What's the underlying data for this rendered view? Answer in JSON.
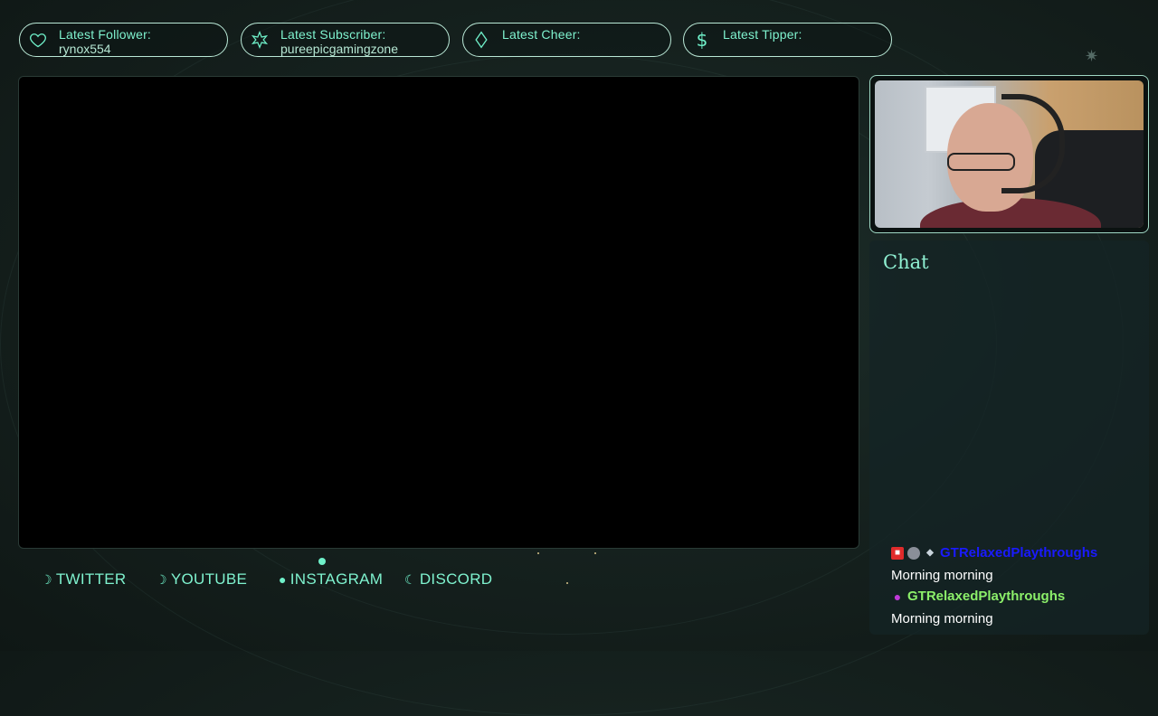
{
  "alerts": [
    {
      "label": "Latest Follower:",
      "value": "rynox554",
      "icon": "heart-icon"
    },
    {
      "label": "Latest Subscriber:",
      "value": "pureepicgamingzone",
      "icon": "star-icon"
    },
    {
      "label": "Latest Cheer:",
      "value": "",
      "icon": "diamond-icon"
    },
    {
      "label": "Latest Tipper:",
      "value": "",
      "icon": "dollar-icon"
    }
  ],
  "chat": {
    "title": "Chat",
    "messages": [
      {
        "user": "GTRelaxedPlaythroughs",
        "text": "Morning morning",
        "name_color": "#1a1aff",
        "badges": [
          "camera-badge",
          "globe-badge",
          "diamond-badge"
        ]
      },
      {
        "user": "GTRelaxedPlaythroughs",
        "text": "Morning morning",
        "name_color": "#8cf06a",
        "badges": [
          "mic-badge"
        ]
      }
    ]
  },
  "socials": [
    {
      "label": "TWITTER",
      "icon": "moon-icon"
    },
    {
      "label": "YOUTUBE",
      "icon": "moon-icon"
    },
    {
      "label": "INSTAGRAM",
      "icon": "full-moon-icon"
    },
    {
      "label": "DISCORD",
      "icon": "crescent-icon"
    }
  ],
  "colors": {
    "accent": "#7ff3cf",
    "border": "#b9e8d6",
    "background": "#16221f"
  }
}
